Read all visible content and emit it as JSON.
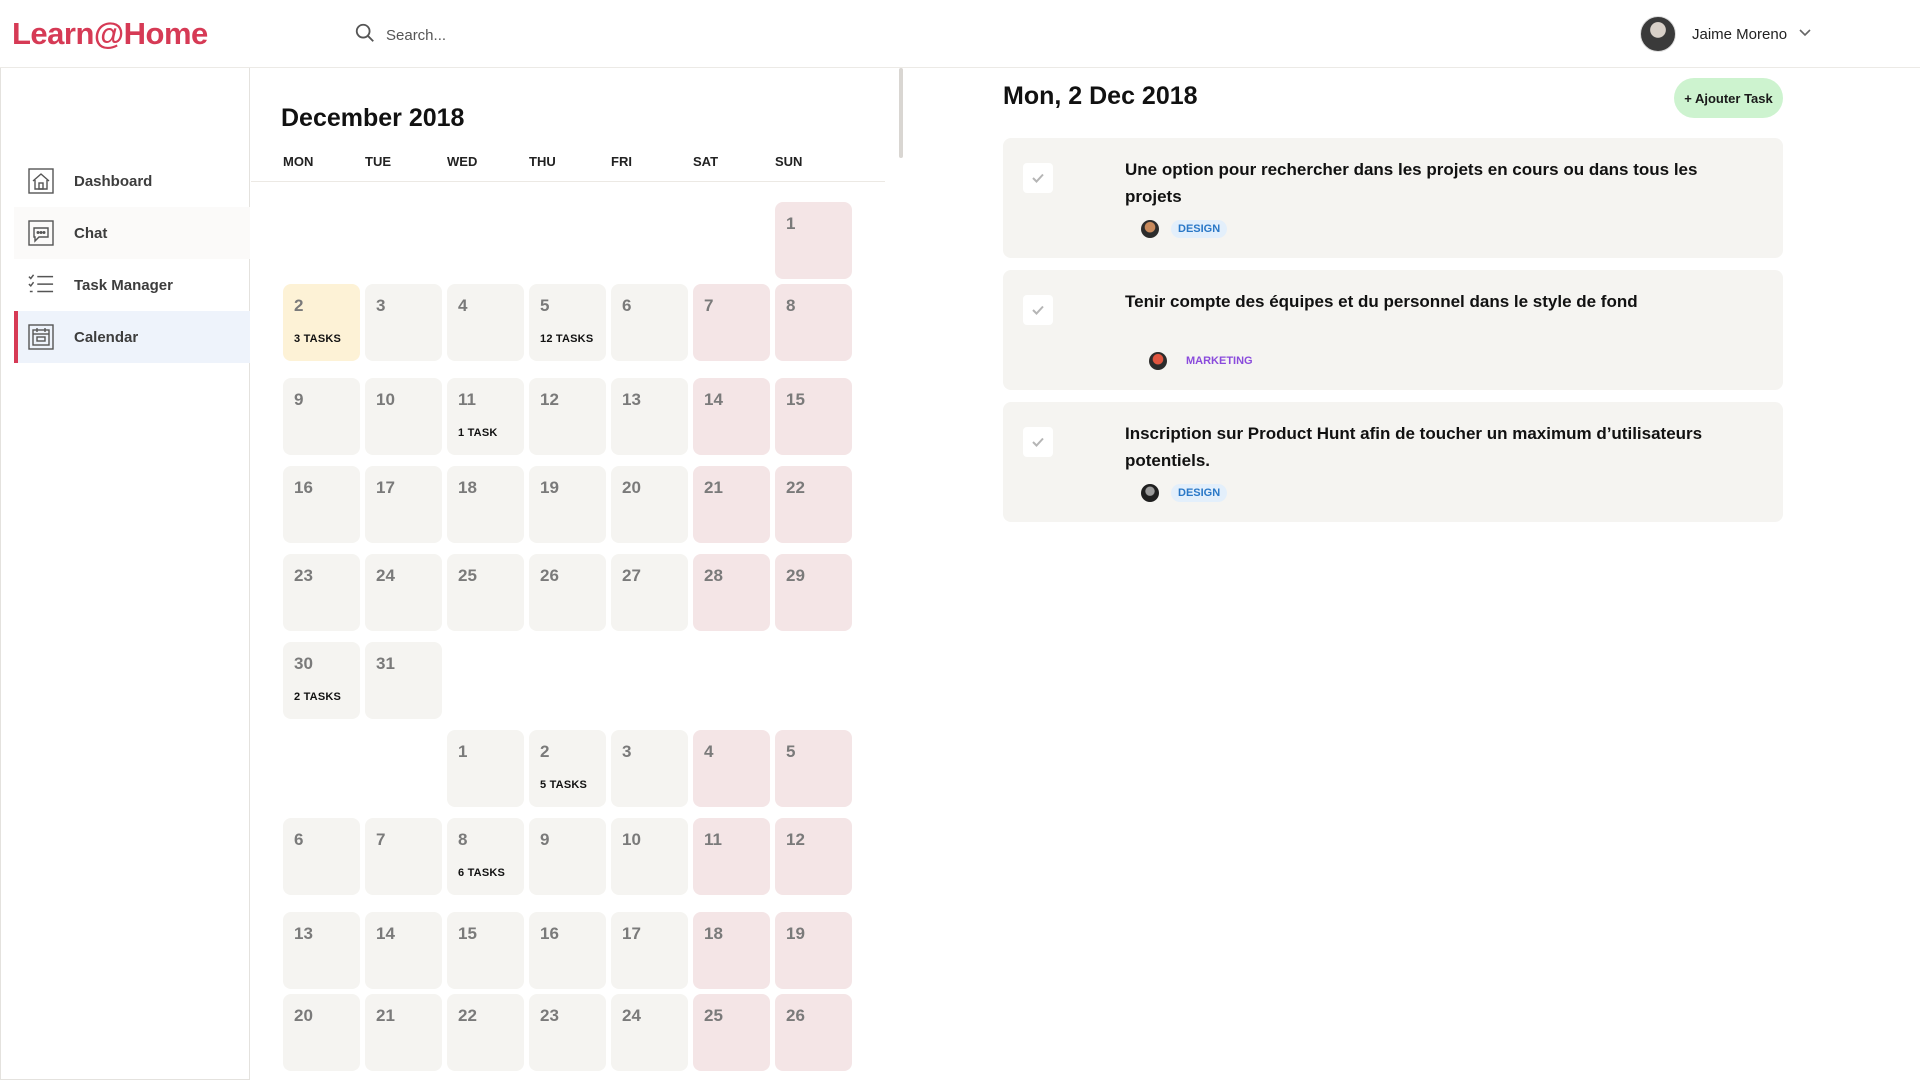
{
  "app": {
    "logo": "Learn@Home"
  },
  "search": {
    "placeholder": "Search..."
  },
  "user": {
    "name": "Jaime Moreno"
  },
  "sidebar": {
    "items": [
      {
        "label": "Dashboard",
        "icon": "home-icon"
      },
      {
        "label": "Chat",
        "icon": "chat-icon"
      },
      {
        "label": "Task Manager",
        "icon": "list-icon"
      },
      {
        "label": "Calendar",
        "icon": "calendar-icon",
        "active": true
      }
    ]
  },
  "calendar": {
    "title": "December 2018",
    "weekdays": [
      "MON",
      "TUE",
      "WED",
      "THU",
      "FRI",
      "SAT",
      "SUN"
    ],
    "weeks": [
      [
        null,
        null,
        null,
        null,
        null,
        null,
        {
          "day": "1"
        }
      ],
      [
        {
          "day": "2",
          "tasks": "3 TASKS",
          "selected": true
        },
        {
          "day": "3"
        },
        {
          "day": "4"
        },
        {
          "day": "5",
          "tasks": "12 TASKS"
        },
        {
          "day": "6"
        },
        {
          "day": "7"
        },
        {
          "day": "8"
        }
      ],
      [
        {
          "day": "9"
        },
        {
          "day": "10"
        },
        {
          "day": "11",
          "tasks": "1 TASK"
        },
        {
          "day": "12"
        },
        {
          "day": "13"
        },
        {
          "day": "14"
        },
        {
          "day": "15"
        }
      ],
      [
        {
          "day": "16"
        },
        {
          "day": "17"
        },
        {
          "day": "18"
        },
        {
          "day": "19"
        },
        {
          "day": "20"
        },
        {
          "day": "21"
        },
        {
          "day": "22"
        }
      ],
      [
        {
          "day": "23"
        },
        {
          "day": "24"
        },
        {
          "day": "25"
        },
        {
          "day": "26"
        },
        {
          "day": "27"
        },
        {
          "day": "28"
        },
        {
          "day": "29"
        }
      ],
      [
        {
          "day": "30",
          "tasks": "2 TASKS"
        },
        {
          "day": "31"
        },
        null,
        null,
        null,
        null,
        null
      ],
      [
        null,
        null,
        {
          "day": "1"
        },
        {
          "day": "2",
          "tasks": "5 TASKS"
        },
        {
          "day": "3"
        },
        {
          "day": "4"
        },
        {
          "day": "5"
        }
      ],
      [
        {
          "day": "6"
        },
        {
          "day": "7"
        },
        {
          "day": "8",
          "tasks": "6 TASKS"
        },
        {
          "day": "9"
        },
        {
          "day": "10"
        },
        {
          "day": "11"
        },
        {
          "day": "12"
        }
      ],
      [
        {
          "day": "13"
        },
        {
          "day": "14"
        },
        {
          "day": "15"
        },
        {
          "day": "16"
        },
        {
          "day": "17"
        },
        {
          "day": "18"
        },
        {
          "day": "19"
        }
      ],
      [
        {
          "day": "20"
        },
        {
          "day": "21"
        },
        {
          "day": "22"
        },
        {
          "day": "23"
        },
        {
          "day": "24"
        },
        {
          "day": "25"
        },
        {
          "day": "26"
        }
      ]
    ]
  },
  "detail": {
    "title": "Mon, 2 Dec 2018",
    "add_label": "+ Ajouter Task",
    "tasks": [
      {
        "text": "Une option pour rechercher dans les projets en cours ou dans tous les projets",
        "tag": "DESIGN"
      },
      {
        "text": "Tenir compte des équipes et du personnel dans le style de fond",
        "tag": "MARKETING"
      },
      {
        "text": "Inscription sur Product Hunt afin de toucher un maximum d’utilisateurs potentiels.",
        "tag": "DESIGN"
      }
    ]
  },
  "colors": {
    "brand": "#d63a55",
    "weekend": "#f4e5e6",
    "weekday": "#f5f4f1",
    "selected": "#fdf2d6",
    "add_button": "#cdf3cf"
  }
}
